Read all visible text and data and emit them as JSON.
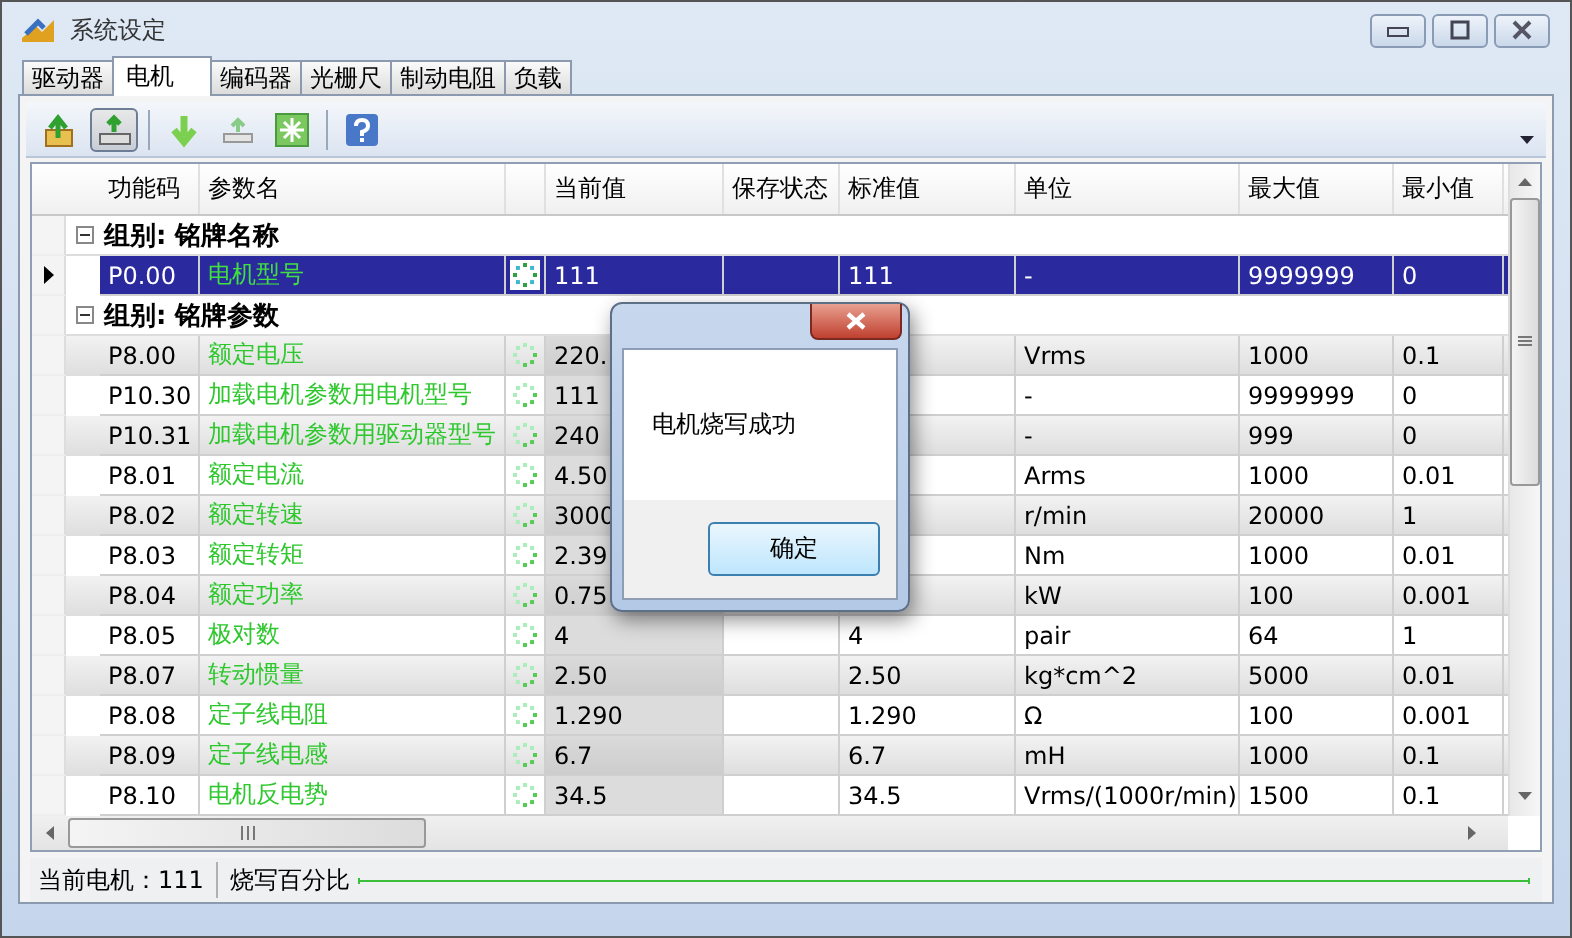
{
  "window": {
    "title": "系统设定"
  },
  "tabs": [
    {
      "label": "驱动器",
      "selected": false
    },
    {
      "label": "电机",
      "selected": true
    },
    {
      "label": "编码器",
      "selected": false
    },
    {
      "label": "光栅尺",
      "selected": false
    },
    {
      "label": "制动电阻",
      "selected": false
    },
    {
      "label": "负载",
      "selected": false
    }
  ],
  "toolbar": [
    {
      "kind": "upload",
      "pressed": false
    },
    {
      "kind": "drive",
      "pressed": true
    },
    {
      "kind": "divider"
    },
    {
      "kind": "download",
      "pressed": false
    },
    {
      "kind": "drive-small",
      "pressed": false
    },
    {
      "kind": "sparkle",
      "pressed": false
    },
    {
      "kind": "divider"
    },
    {
      "kind": "help",
      "pressed": false
    }
  ],
  "table": {
    "columns": [
      "功能码",
      "参数名",
      "当前值",
      "保存状态",
      "标准值",
      "单位",
      "最大值",
      "最小值"
    ],
    "groups": [
      {
        "title": "组别: 铭牌名称",
        "expanded": true,
        "rows": [
          {
            "code": "P0.00",
            "name": "电机型号",
            "current": "111",
            "standard": "111",
            "unit": "-",
            "max": "9999999",
            "min": "0",
            "selected": true
          }
        ]
      },
      {
        "title": "组别: 铭牌参数",
        "expanded": true,
        "rows": [
          {
            "code": "P8.00",
            "name": "额定电压",
            "current": "220.",
            "unit": "Vrms",
            "max": "1000",
            "min": "0.1",
            "selected": false
          },
          {
            "code": "P10.30",
            "name": "加载电机参数用电机型号",
            "current": "111",
            "unit": "-",
            "max": "9999999",
            "min": "0",
            "selected": false
          },
          {
            "code": "P10.31",
            "name": "加载电机参数用驱动器型号",
            "current": "240",
            "unit": "-",
            "max": "999",
            "min": "0",
            "selected": false
          },
          {
            "code": "P8.01",
            "name": "额定电流",
            "current": "4.50",
            "unit": "Arms",
            "max": "1000",
            "min": "0.01",
            "selected": false
          },
          {
            "code": "P8.02",
            "name": "额定转速",
            "current": "3000",
            "unit": "r/min",
            "max": "20000",
            "min": "1",
            "selected": false
          },
          {
            "code": "P8.03",
            "name": "额定转矩",
            "current": "2.39",
            "unit": "Nm",
            "max": "1000",
            "min": "0.01",
            "selected": false
          },
          {
            "code": "P8.04",
            "name": "额定功率",
            "current": "0.75",
            "unit": "kW",
            "max": "100",
            "min": "0.001",
            "selected": false
          },
          {
            "code": "P8.05",
            "name": "极对数",
            "current": "4",
            "standard": "4",
            "unit": "pair",
            "max": "64",
            "min": "1",
            "selected": false
          },
          {
            "code": "P8.07",
            "name": "转动惯量",
            "current": "2.50",
            "standard": "2.50",
            "unit": "kg*cm^2",
            "max": "5000",
            "min": "0.01",
            "selected": false
          },
          {
            "code": "P8.08",
            "name": "定子线电阻",
            "current": "1.290",
            "standard": "1.290",
            "unit": "Ω",
            "max": "100",
            "min": "0.001",
            "selected": false
          },
          {
            "code": "P8.09",
            "name": "定子线电感",
            "current": "6.7",
            "standard": "6.7",
            "unit": "mH",
            "max": "1000",
            "min": "0.1",
            "selected": false
          },
          {
            "code": "P8.10",
            "name": "电机反电势",
            "current": "34.5",
            "standard": "34.5",
            "unit": "Vrms/(1000r/min)",
            "max": "1500",
            "min": "0.1",
            "selected": false
          }
        ]
      }
    ]
  },
  "dialog": {
    "message": "电机烧写成功",
    "button": "确定"
  },
  "status_bar": {
    "motor": "当前电机：111",
    "progress_label": "烧写百分比",
    "level": 1
  }
}
